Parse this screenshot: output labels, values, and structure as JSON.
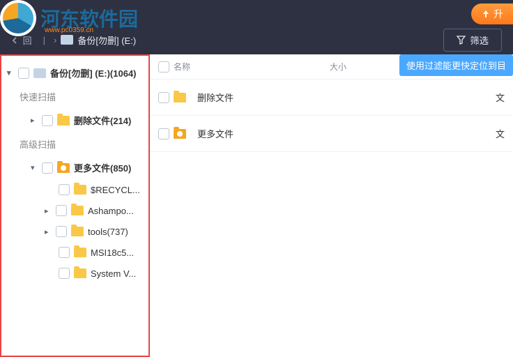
{
  "logo": {
    "title": "河东软件园",
    "sub": "www.pc0359.cn"
  },
  "topbar": {
    "upgrade": "升"
  },
  "pathbar": {
    "back": "回",
    "path": "备份[勿删] (E:)",
    "filter": "筛选"
  },
  "tooltip": "使用过滤能更快定位到目",
  "sidebar": {
    "root": "备份[勿删] (E:)(1064)",
    "quick_label": "快速扫描",
    "deep_label": "高级扫描",
    "quick": [
      {
        "label": "删除文件(214)"
      }
    ],
    "deep_root": "更多文件(850)",
    "deep": [
      {
        "label": "$RECYCL..."
      },
      {
        "label": "Ashampo..."
      },
      {
        "label": "tools(737)"
      },
      {
        "label": "MSI18c5..."
      },
      {
        "label": "System V..."
      }
    ]
  },
  "list": {
    "headers": {
      "name": "名称",
      "size": "大小"
    },
    "rows": [
      {
        "name": "删除文件",
        "type": "文"
      },
      {
        "name": "更多文件",
        "type": "文"
      }
    ]
  }
}
